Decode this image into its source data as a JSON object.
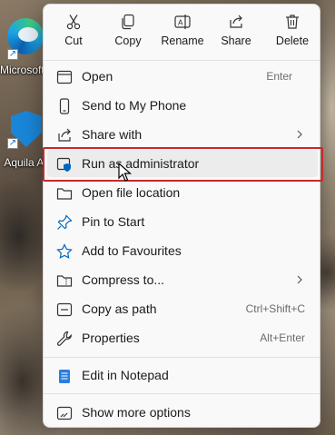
{
  "desktop": {
    "icons": [
      {
        "label": "Microsoft Edge",
        "icon": "edge-icon"
      },
      {
        "label": "Aquila AI",
        "icon": "aquila-icon"
      }
    ]
  },
  "toolbar": {
    "cut": "Cut",
    "copy": "Copy",
    "rename": "Rename",
    "share": "Share",
    "delete": "Delete"
  },
  "menu": {
    "items": [
      {
        "label": "Open",
        "shortcut": "Enter",
        "icon": "open-icon"
      },
      {
        "label": "Send to My Phone",
        "shortcut": "",
        "icon": "phone-icon"
      },
      {
        "label": "Share with",
        "shortcut": "",
        "icon": "share-with-icon",
        "submenu": true
      },
      {
        "label": "Run as administrator",
        "shortcut": "",
        "icon": "shield-icon"
      },
      {
        "label": "Open file location",
        "shortcut": "",
        "icon": "folder-icon"
      },
      {
        "label": "Pin to Start",
        "shortcut": "",
        "icon": "pin-icon"
      },
      {
        "label": "Add to Favourites",
        "shortcut": "",
        "icon": "star-icon"
      },
      {
        "label": "Compress to...",
        "shortcut": "",
        "icon": "zip-folder-icon",
        "submenu": true
      },
      {
        "label": "Copy as path",
        "shortcut": "Ctrl+Shift+C",
        "icon": "copy-path-icon"
      },
      {
        "label": "Properties",
        "shortcut": "Alt+Enter",
        "icon": "wrench-icon"
      },
      {
        "label": "Edit in Notepad",
        "shortcut": "",
        "icon": "notepad-icon"
      },
      {
        "label": "Show more options",
        "shortcut": "",
        "icon": "more-options-icon"
      }
    ]
  },
  "colors": {
    "highlight_border": "#c92a2a",
    "accent": "#0067c0"
  }
}
